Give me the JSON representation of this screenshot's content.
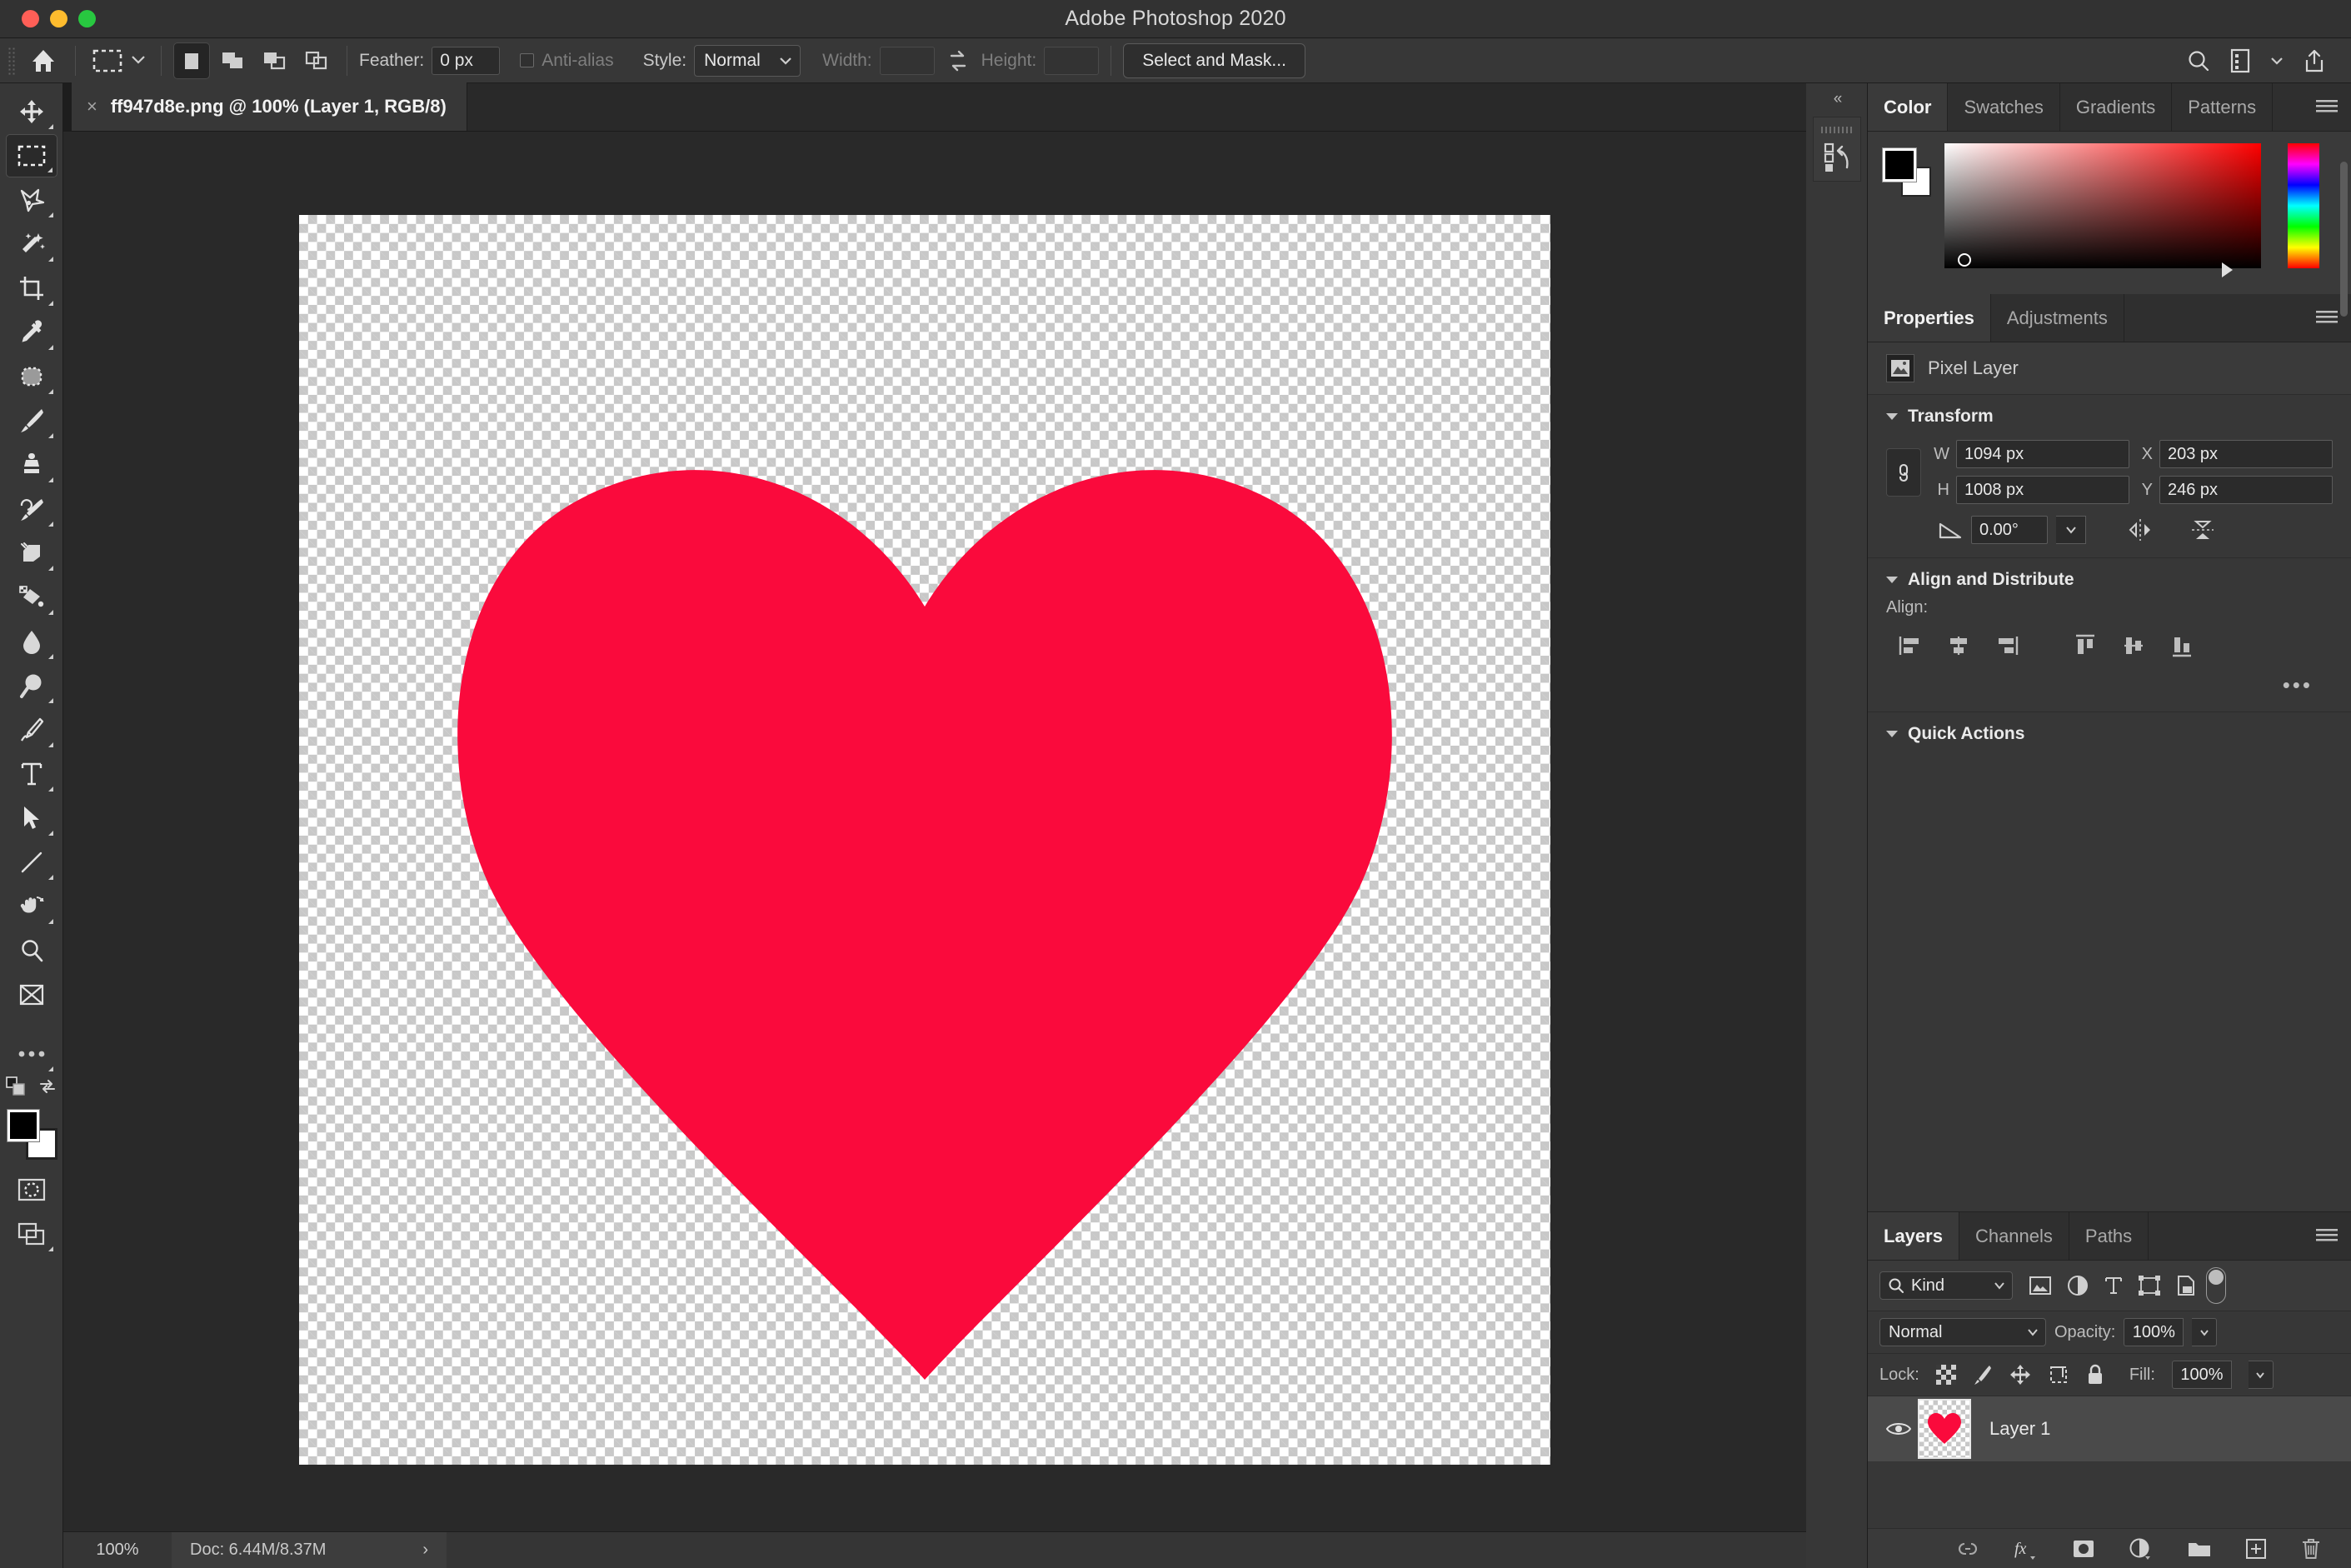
{
  "window": {
    "title": "Adobe Photoshop 2020",
    "traffic_lights": [
      "close",
      "minimize",
      "zoom"
    ]
  },
  "options_bar": {
    "home_icon": "home-icon",
    "tool_preset_icon": "rectangular-marquee-icon",
    "selection_modes": [
      {
        "name": "new-selection",
        "active": true
      },
      {
        "name": "add-to-selection",
        "active": false
      },
      {
        "name": "subtract-from-selection",
        "active": false
      },
      {
        "name": "intersect-with-selection",
        "active": false
      }
    ],
    "feather_label": "Feather:",
    "feather_value": "0 px",
    "antialias_label": "Anti-alias",
    "antialias_checked": false,
    "style_label": "Style:",
    "style_value": "Normal",
    "width_label": "Width:",
    "width_value": "",
    "height_label": "Height:",
    "height_value": "",
    "swap_icon": "swap-dimensions-icon",
    "select_and_mask": "Select and Mask...",
    "right_icons": [
      "search-icon",
      "workspace-icon",
      "chevron-down-icon",
      "share-icon"
    ]
  },
  "document_tab": {
    "close_glyph": "×",
    "title": "ff947d8e.png @ 100% (Layer 1, RGB/8)"
  },
  "toolbar": {
    "tools": [
      {
        "name": "move-tool",
        "active": false
      },
      {
        "name": "rectangular-marquee-tool",
        "active": true
      },
      {
        "name": "lasso-tool",
        "active": false
      },
      {
        "name": "object-selection-tool",
        "active": false
      },
      {
        "name": "crop-tool",
        "active": false
      },
      {
        "name": "eyedropper-tool",
        "active": false
      },
      {
        "name": "spot-healing-brush-tool",
        "active": false
      },
      {
        "name": "brush-tool",
        "active": false
      },
      {
        "name": "clone-stamp-tool",
        "active": false
      },
      {
        "name": "history-brush-tool",
        "active": false
      },
      {
        "name": "eraser-tool",
        "active": false
      },
      {
        "name": "gradient-tool",
        "active": false
      },
      {
        "name": "blur-tool",
        "active": false
      },
      {
        "name": "dodge-tool",
        "active": false
      },
      {
        "name": "pen-tool",
        "active": false
      },
      {
        "name": "type-tool",
        "active": false
      },
      {
        "name": "path-selection-tool",
        "active": false
      },
      {
        "name": "line-tool",
        "active": false
      },
      {
        "name": "hand-tool",
        "active": false
      },
      {
        "name": "zoom-tool",
        "active": false
      },
      {
        "name": "edit-toolbar-tool",
        "active": false
      }
    ],
    "more_tools": "...",
    "foreground_color": "#000000",
    "background_color": "#ffffff",
    "default_colors_icon": "default-colors-icon",
    "swap_colors_icon": "swap-colors-icon",
    "quick_mask_icon": "quick-mask-icon",
    "screen_mode_icon": "screen-mode-icon"
  },
  "canvas": {
    "shape": "heart",
    "heart_color": "#FA0A3C",
    "background": "transparent-checkerboard",
    "zoom": "100%"
  },
  "status_bar": {
    "zoom": "100%",
    "doc_info": "Doc: 6.44M/8.37M",
    "expand_glyph": "›"
  },
  "dock": {
    "collapse_glyph": "«",
    "button_icon": "history-actions-icon"
  },
  "color_panel": {
    "tabs": [
      {
        "label": "Color",
        "active": true
      },
      {
        "label": "Swatches",
        "active": false
      },
      {
        "label": "Gradients",
        "active": false
      },
      {
        "label": "Patterns",
        "active": false
      }
    ],
    "menu_icon": "panel-menu-icon",
    "foreground": "#000000",
    "background": "#ffffff",
    "spectrum": "hsb-ramp-red",
    "hue_slider": "hue-strip"
  },
  "properties_panel": {
    "tabs": [
      {
        "label": "Properties",
        "active": true
      },
      {
        "label": "Adjustments",
        "active": false
      }
    ],
    "menu_icon": "panel-menu-icon",
    "layer_type_icon": "pixel-layer-icon",
    "layer_type": "Pixel Layer",
    "transform": {
      "title": "Transform",
      "link_icon": "link-constrain-icon",
      "w_label": "W",
      "w_value": "1094 px",
      "x_label": "X",
      "x_value": "203 px",
      "h_label": "H",
      "h_value": "1008 px",
      "y_label": "Y",
      "y_value": "246 px",
      "angle_icon": "angle-icon",
      "angle_value": "0.00°",
      "flip_horizontal_icon": "flip-horizontal-icon",
      "flip_vertical_icon": "flip-vertical-icon"
    },
    "align": {
      "title": "Align and Distribute",
      "label": "Align:",
      "buttons": [
        "align-left-edges-icon",
        "align-horizontal-centers-icon",
        "align-right-edges-icon",
        "align-top-edges-icon",
        "align-vertical-centers-icon",
        "align-bottom-edges-icon"
      ],
      "more_glyph": "•••"
    },
    "quick_actions": {
      "title": "Quick Actions"
    }
  },
  "layers_panel": {
    "tabs": [
      {
        "label": "Layers",
        "active": true
      },
      {
        "label": "Channels",
        "active": false
      },
      {
        "label": "Paths",
        "active": false
      }
    ],
    "menu_icon": "panel-menu-icon",
    "filter_label": "Kind",
    "filter_icons": [
      "filter-pixel-icon",
      "filter-adjustment-icon",
      "filter-type-icon",
      "filter-shape-icon",
      "filter-smart-object-icon"
    ],
    "filter_toggle": "filter-enable-toggle",
    "blend_mode": "Normal",
    "opacity_label": "Opacity:",
    "opacity_value": "100%",
    "lock_label": "Lock:",
    "lock_icons": [
      "lock-transparent-pixels-icon",
      "lock-image-pixels-icon",
      "lock-position-icon",
      "lock-artboard-nesting-icon",
      "lock-all-icon"
    ],
    "fill_label": "Fill:",
    "fill_value": "100%",
    "layers": [
      {
        "name": "Layer 1",
        "visible": true,
        "visibility_icon": "eye-icon",
        "thumbnail": "heart-thumbnail",
        "selected": true
      }
    ],
    "bottom_icons": [
      "link-layers-icon",
      "layer-style-fx-icon",
      "add-layer-mask-icon",
      "new-adjustment-layer-icon",
      "new-group-icon",
      "new-layer-icon",
      "delete-layer-icon"
    ]
  }
}
